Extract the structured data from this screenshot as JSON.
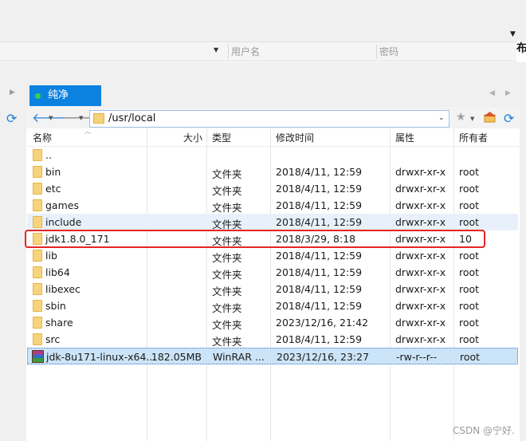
{
  "top": {
    "edge_char": "布"
  },
  "connection": {
    "username_placeholder": "用户名",
    "password_placeholder": "密码"
  },
  "tab": {
    "label": "纯净"
  },
  "path": {
    "value": "/usr/local"
  },
  "columns": {
    "name": "名称",
    "size": "大小",
    "type": "类型",
    "modified": "修改时间",
    "attributes": "属性",
    "owner": "所有者"
  },
  "files": [
    {
      "name": "..",
      "size": "",
      "type": "",
      "modified": "",
      "attributes": "",
      "owner": ""
    },
    {
      "name": "bin",
      "size": "",
      "type": "文件夹",
      "modified": "2018/4/11, 12:59",
      "attributes": "drwxr-xr-x",
      "owner": "root"
    },
    {
      "name": "etc",
      "size": "",
      "type": "文件夹",
      "modified": "2018/4/11, 12:59",
      "attributes": "drwxr-xr-x",
      "owner": "root"
    },
    {
      "name": "games",
      "size": "",
      "type": "文件夹",
      "modified": "2018/4/11, 12:59",
      "attributes": "drwxr-xr-x",
      "owner": "root"
    },
    {
      "name": "include",
      "size": "",
      "type": "文件夹",
      "modified": "2018/4/11, 12:59",
      "attributes": "drwxr-xr-x",
      "owner": "root"
    },
    {
      "name": "jdk1.8.0_171",
      "size": "",
      "type": "文件夹",
      "modified": "2018/3/29, 8:18",
      "attributes": "drwxr-xr-x",
      "owner": "10"
    },
    {
      "name": "lib",
      "size": "",
      "type": "文件夹",
      "modified": "2018/4/11, 12:59",
      "attributes": "drwxr-xr-x",
      "owner": "root"
    },
    {
      "name": "lib64",
      "size": "",
      "type": "文件夹",
      "modified": "2018/4/11, 12:59",
      "attributes": "drwxr-xr-x",
      "owner": "root"
    },
    {
      "name": "libexec",
      "size": "",
      "type": "文件夹",
      "modified": "2018/4/11, 12:59",
      "attributes": "drwxr-xr-x",
      "owner": "root"
    },
    {
      "name": "sbin",
      "size": "",
      "type": "文件夹",
      "modified": "2018/4/11, 12:59",
      "attributes": "drwxr-xr-x",
      "owner": "root"
    },
    {
      "name": "share",
      "size": "",
      "type": "文件夹",
      "modified": "2023/12/16, 21:42",
      "attributes": "drwxr-xr-x",
      "owner": "root"
    },
    {
      "name": "src",
      "size": "",
      "type": "文件夹",
      "modified": "2018/4/11, 12:59",
      "attributes": "drwxr-xr-x",
      "owner": "root"
    },
    {
      "name": "jdk-8u171-linux-x64...",
      "size": "182.05MB",
      "type": "WinRAR ...",
      "modified": "2023/12/16, 23:27",
      "attributes": "-rw-r--r--",
      "owner": "root"
    }
  ],
  "watermark": "CSDN @宁好."
}
